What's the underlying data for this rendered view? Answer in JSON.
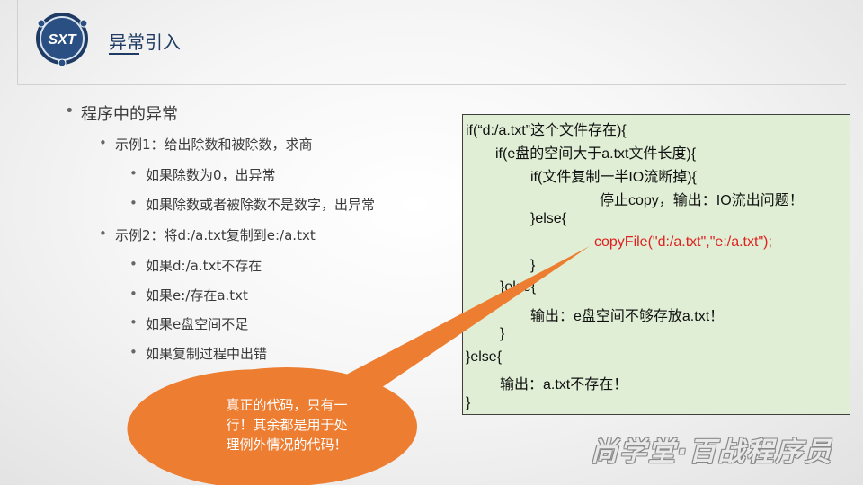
{
  "header": {
    "logo_text": "SXT",
    "title": "异常引入"
  },
  "bullets": {
    "b1": "程序中的异常",
    "b1_1": "示例1：给出除数和被除数，求商",
    "b1_1_1": "如果除数为0，出异常",
    "b1_1_2": "如果除数或者被除数不是数字，出异常",
    "b1_2": "示例2：将d:/a.txt复制到e:/a.txt",
    "b1_2_1": "如果d:/a.txt不存在",
    "b1_2_2": "如果e:/存在a.txt",
    "b1_2_3": "如果e盘空间不足",
    "b1_2_4": "如果复制过程中出错"
  },
  "code": {
    "line1": "if(“d:/a.txt”这个文件存在){",
    "line2": "if(e盘的空间大于a.txt文件长度){",
    "line3": "if(文件复制一半IO流断掉){",
    "line4": "停止copy，输出：IO流出问题！",
    "line5": "}else{",
    "line6": "copyFile(\"d:/a.txt\",\"e:/a.txt\");",
    "line7": "}",
    "line8": "}else{",
    "line9": "输出：e盘空间不够存放a.txt！",
    "line10": "}",
    "line11": "}else{",
    "line12": "输出：a.txt不存在！",
    "line13": "}"
  },
  "callout": {
    "text_line1": "真正的代码，只有一",
    "text_line2": "行！其余都是用于处",
    "text_line3": "理例外情况的代码！"
  },
  "watermark": "尚学堂·百战程序员",
  "colors": {
    "title": "#1f3b63",
    "code_bg": "#dfeed4",
    "highlight_code": "#e02020",
    "callout": "#ed7d31"
  }
}
